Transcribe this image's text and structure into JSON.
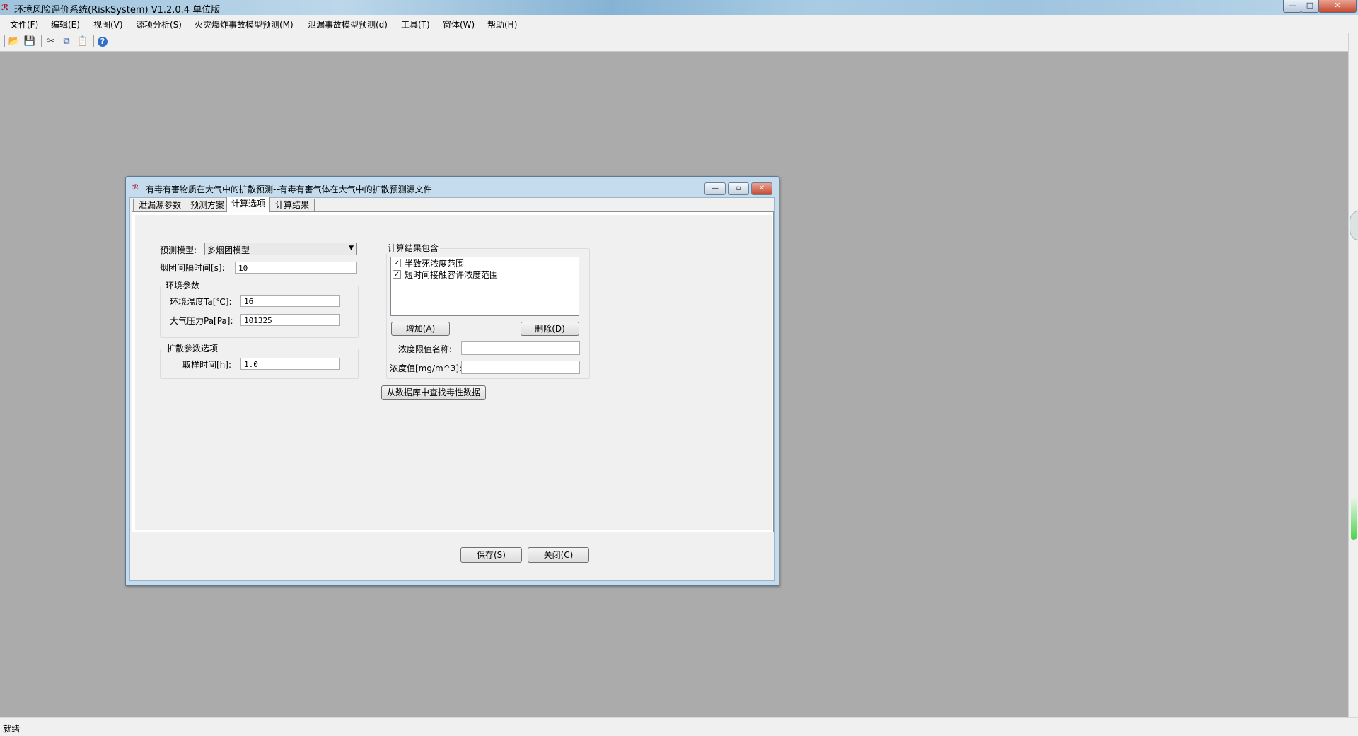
{
  "app": {
    "title": "环境风险评价系统(RiskSystem) V1.2.0.4 单位版",
    "icon": "app-logo-icon",
    "caption_buttons": {
      "minimize": "—",
      "maximize": "□",
      "close": "✕"
    }
  },
  "menubar": {
    "items": [
      "文件(F)",
      "编辑(E)",
      "视图(V)",
      "源项分析(S)",
      "火灾爆炸事故模型预测(M)",
      "泄漏事故模型预测(d)",
      "工具(T)",
      "窗体(W)",
      "帮助(H)"
    ]
  },
  "toolbar": {
    "icons": [
      "open-folder-icon",
      "save-icon",
      "cut-icon",
      "copy-icon",
      "paste-icon",
      "help-icon"
    ],
    "glyphs": [
      "📂",
      "💾",
      "✂",
      "⧉",
      "📋",
      "?"
    ]
  },
  "status": {
    "text": "就绪"
  },
  "dialog": {
    "title": "有毒有害物质在大气中的扩散预测--有毒有害气体在大气中的扩散预测源文件",
    "caption_buttons": {
      "minimize": "—",
      "maximize": "▫",
      "close": "✕"
    },
    "tabs": [
      "泄漏源参数",
      "预测方案",
      "计算选项",
      "计算结果"
    ],
    "active_tab": "计算选项",
    "options": {
      "model_label": "预测模型:",
      "model_value": "多烟团模型",
      "interval_label": "烟团间隔时间[s]:",
      "interval_value": "10",
      "env_group_title": "环境参数",
      "temp_label": "环境温度Ta[℃]:",
      "temp_value": "16",
      "pressure_label": "大气压力Pa[Pa]:",
      "pressure_value": "101325",
      "diffusion_group_title": "扩散参数选项",
      "sampling_label": "取样时间[h]:",
      "sampling_value": "1.0"
    },
    "results": {
      "group_title": "计算结果包含",
      "items": [
        {
          "label": "半致死浓度范围",
          "checked": true
        },
        {
          "label": "短时间接触容许浓度范围",
          "checked": true
        }
      ],
      "add_button": "增加(A)",
      "delete_button": "删除(D)",
      "limit_name_label": "浓度限值名称:",
      "limit_name_value": "",
      "conc_label": "浓度值[mg/m^3]:",
      "conc_value": "",
      "db_button": "从数据库中查找毒性数据"
    },
    "footer": {
      "save_button": "保存(S)",
      "close_button": "关闭(C)"
    }
  }
}
